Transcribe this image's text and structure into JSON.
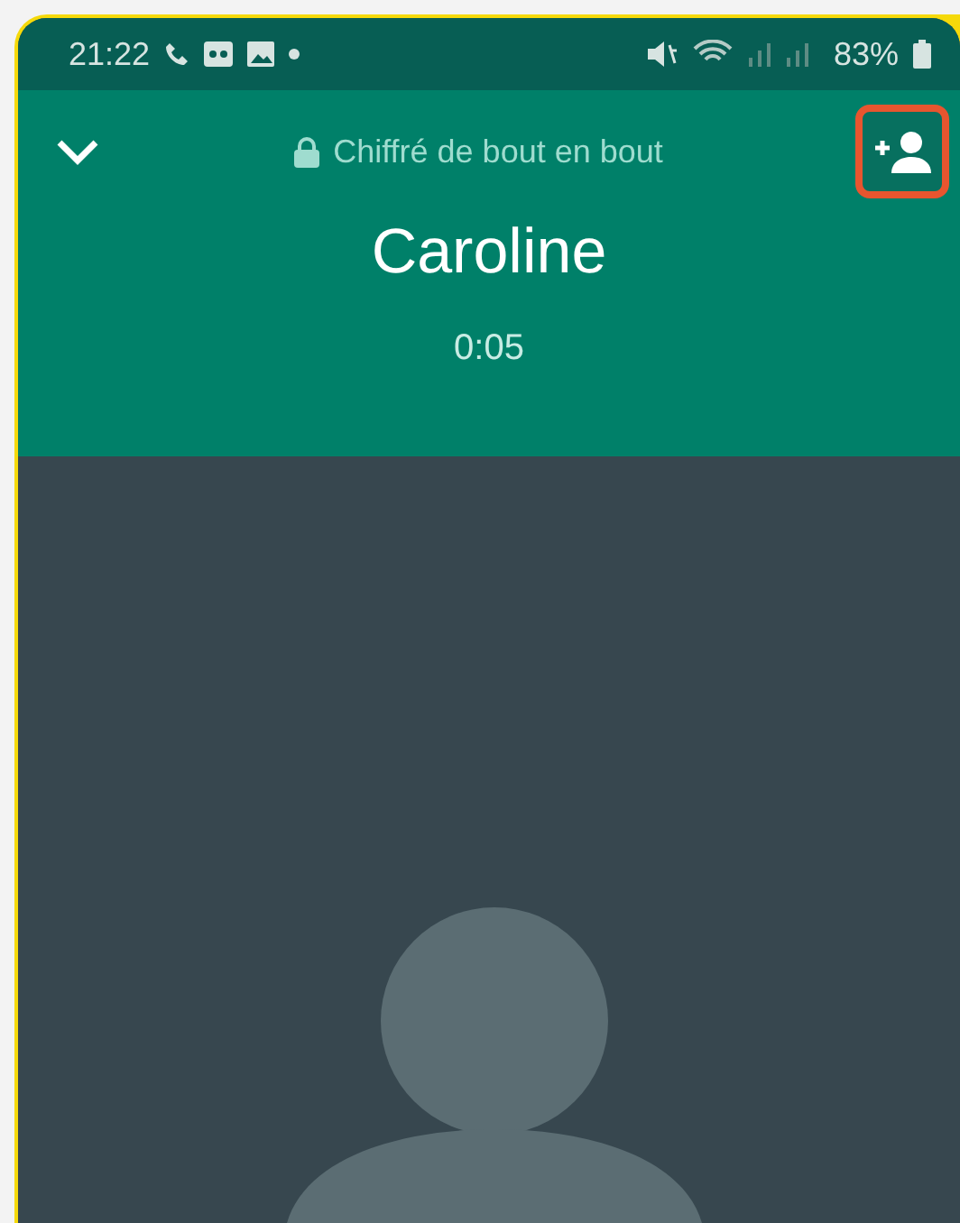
{
  "status_bar": {
    "time": "21:22",
    "battery": "83%"
  },
  "header": {
    "encryption": "Chiffré de bout en bout",
    "contact": "Caroline",
    "duration": "0:05"
  }
}
